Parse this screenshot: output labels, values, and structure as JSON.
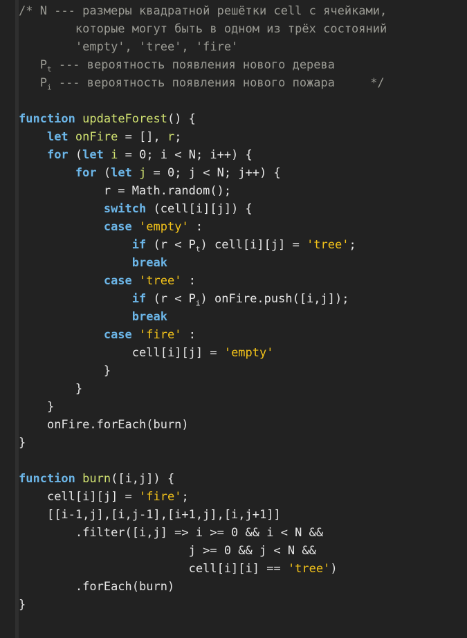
{
  "editor": {
    "background": "#222222",
    "gutter_color": "#2f2f2f",
    "language": "JavaScript",
    "colors": {
      "comment": "#9a9a93",
      "keyword": "#6cb6e8",
      "function_name": "#cfe070",
      "declaration": "#cfe070",
      "string": "#f2c21a",
      "plain": "#e6e6e6"
    }
  },
  "code": {
    "comment_block": {
      "line1_open": "/* ",
      "line1_a": "N --- ",
      "line1_b": "размеры квадратной решётки cell с ячейками,",
      "line2": "которые могут быть в одном из трёх состояний",
      "line3": "'empty', 'tree', 'fire'",
      "line4_var": "P",
      "line4_sub": "t",
      "line4_text": " --- вероятность появления нового дерева",
      "line5_var": "P",
      "line5_sub": "i",
      "line5_text": " --- вероятность появления нового пожара",
      "line5_close": "*/"
    },
    "fn_update": {
      "kw_function": "function",
      "name": "updateForest",
      "sig_tail": "() {",
      "let_kw": "let",
      "let_decl_onfire": "onFire",
      "let_rest_a": " = [], ",
      "let_decl_r": "r",
      "let_rest_b": ";",
      "for_i_kw": "for",
      "for_i_open": " (",
      "for_i_let": "let",
      "for_i_var": "i",
      "for_i_rest": " = 0; i < N; i++) {",
      "for_j_kw": "for",
      "for_j_open": " (",
      "for_j_let": "let",
      "for_j_var": "j",
      "for_j_rest": " = 0; j < N; j++) {",
      "rand_line": "r = Math.random();",
      "switch_kw": "switch",
      "switch_rest": " (cell[i][j]) {",
      "case_empty_kw": "case",
      "case_empty_str": "'empty'",
      "case_empty_tail": " :",
      "if_t_kw": "if",
      "if_t_a": " (r < P",
      "if_t_sub": "t",
      "if_t_b": ") cell[i][j] = ",
      "if_t_str": "'tree'",
      "if_t_c": ";",
      "break1": "break",
      "case_tree_kw": "case",
      "case_tree_str": "'tree'",
      "case_tree_tail": " :",
      "if_i_kw": "if",
      "if_i_a": " (r < P",
      "if_i_sub": "i",
      "if_i_b": ") onFire.push([i,j]);",
      "break2": "break",
      "case_fire_kw": "case",
      "case_fire_str": "'fire'",
      "case_fire_tail": " :",
      "assign_empty_a": "cell[i][j] = ",
      "assign_empty_str": "'empty'",
      "close_switch": "}",
      "close_for_j": "}",
      "close_for_i": "}",
      "foreach_line": "onFire.forEach(burn)",
      "close_fn": "}"
    },
    "fn_burn": {
      "kw_function": "function",
      "name": "burn",
      "sig_tail": "([i,j]) {",
      "assign_fire_a": "cell[i][j] = ",
      "assign_fire_str": "'fire'",
      "assign_fire_b": ";",
      "neighbors": "[[i-1,j],[i,j-1],[i+1,j],[i,j+1]]",
      "filter_line1": ".filter([i,j] => i >= 0 && i < N &&",
      "filter_line2": "j >= 0 && j < N &&",
      "filter_line3_a": "cell[i][i] == ",
      "filter_line3_str": "'tree'",
      "filter_line3_b": ")",
      "foreach_line": ".forEach(burn)",
      "close_fn": "}"
    }
  }
}
